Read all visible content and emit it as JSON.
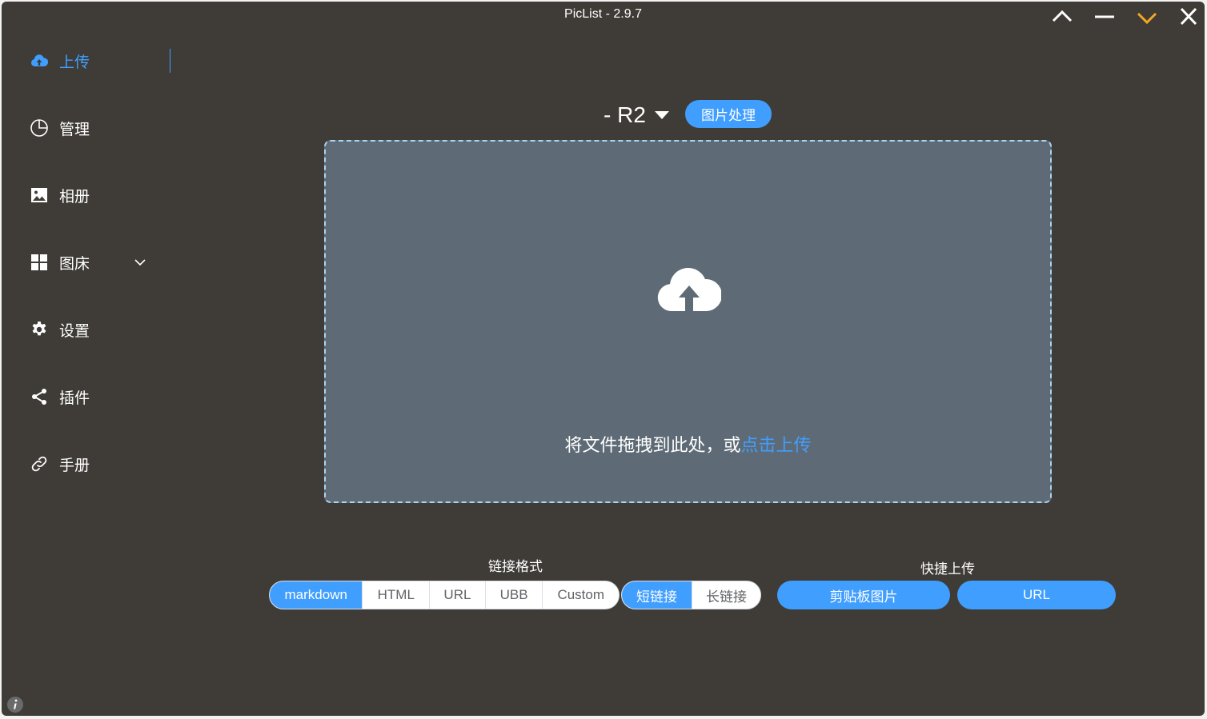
{
  "window": {
    "title": "PicList - 2.9.7"
  },
  "sidebar": {
    "items": [
      {
        "label": "上传",
        "icon": "upload-cloud-icon",
        "active": true
      },
      {
        "label": "管理",
        "icon": "pie-chart-icon"
      },
      {
        "label": "相册",
        "icon": "image-icon"
      },
      {
        "label": "图床",
        "icon": "grid-icon",
        "expandable": true
      },
      {
        "label": "设置",
        "icon": "gear-icon"
      },
      {
        "label": "插件",
        "icon": "share-icon"
      },
      {
        "label": "手册",
        "icon": "link-icon"
      }
    ]
  },
  "upload": {
    "picbed_label": "- R2",
    "image_process_label": "图片处理",
    "drop_text": "将文件拖拽到此处，或",
    "drop_link": "点击上传"
  },
  "link_format": {
    "label": "链接格式",
    "options": [
      "markdown",
      "HTML",
      "URL",
      "UBB",
      "Custom"
    ],
    "selected": "markdown"
  },
  "link_length": {
    "options": [
      "短链接",
      "长链接"
    ],
    "selected": "短链接"
  },
  "quick_upload": {
    "label": "快捷上传",
    "clipboard_label": "剪贴板图片",
    "url_label": "URL"
  },
  "colors": {
    "accent": "#409eff",
    "background": "#3f3c37",
    "dropzone": "#5e6b76",
    "minimize_on_top_active": "#f5a623"
  }
}
